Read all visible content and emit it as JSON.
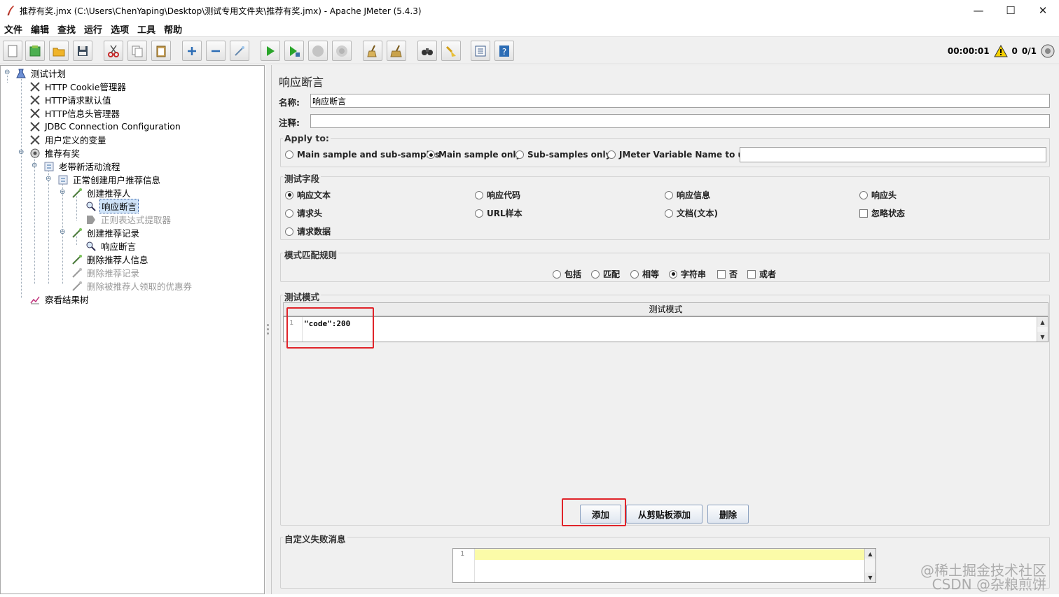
{
  "window": {
    "title": "推荐有奖.jmx (C:\\Users\\ChenYaping\\Desktop\\测试专用文件夹\\推荐有奖.jmx) - Apache JMeter (5.4.3)",
    "minimize": "—",
    "maximize": "☐",
    "close": "✕"
  },
  "menu": [
    "文件",
    "编辑",
    "查找",
    "运行",
    "选项",
    "工具",
    "帮助"
  ],
  "toolbar": {
    "timer": "00:00:01",
    "warnings": "0",
    "threads": "0/1"
  },
  "tree": {
    "items": [
      {
        "label": "测试计划",
        "icon": "test-plan-icon"
      },
      {
        "label": "HTTP Cookie管理器",
        "icon": "config-icon"
      },
      {
        "label": "HTTP请求默认值",
        "icon": "config-icon"
      },
      {
        "label": "HTTP信息头管理器",
        "icon": "config-icon"
      },
      {
        "label": "JDBC Connection Configuration",
        "icon": "config-icon"
      },
      {
        "label": "用户定义的变量",
        "icon": "config-icon"
      },
      {
        "label": "推荐有奖",
        "icon": "thread-group-icon"
      },
      {
        "label": "老带新活动流程",
        "icon": "controller-icon"
      },
      {
        "label": "正常创建用户推荐信息",
        "icon": "controller-icon"
      },
      {
        "label": "创建推荐人",
        "icon": "sampler-icon"
      },
      {
        "label": "响应断言",
        "icon": "assertion-icon"
      },
      {
        "label": "正则表达式提取器",
        "icon": "extractor-icon"
      },
      {
        "label": "创建推荐记录",
        "icon": "sampler-icon"
      },
      {
        "label": "响应断言",
        "icon": "assertion-icon"
      },
      {
        "label": "删除推荐人信息",
        "icon": "sampler-icon"
      },
      {
        "label": "删除推荐记录",
        "icon": "sampler-icon"
      },
      {
        "label": "删除被推荐人领取的优惠券",
        "icon": "sampler-icon"
      },
      {
        "label": "察看结果树",
        "icon": "listener-icon"
      }
    ]
  },
  "panel": {
    "heading": "响应断言",
    "name_label": "名称:",
    "name_value": "响应断言",
    "comment_label": "注释:",
    "comment_value": "",
    "apply_to": {
      "title": "Apply to:",
      "options": [
        "Main sample and sub-samples",
        "Main sample only",
        "Sub-samples only",
        "JMeter Variable Name to use"
      ],
      "selected": "Main sample only",
      "variable_value": ""
    },
    "field_to_test": {
      "title": "测试字段",
      "options": [
        "响应文本",
        "响应代码",
        "响应信息",
        "响应头",
        "请求头",
        "URL样本",
        "文档(文本)",
        "忽略状态",
        "请求数据"
      ],
      "selected": "响应文本",
      "ignore_status_checked": false
    },
    "pattern_rules": {
      "title": "模式匹配规则",
      "options": [
        "包括",
        "匹配",
        "相等",
        "字符串",
        "否",
        "或者"
      ],
      "selected": "字符串"
    },
    "patterns": {
      "title": "测试模式",
      "column_header": "测试模式",
      "line_number": "1",
      "value": "\"code\":200"
    },
    "buttons": {
      "add": "添加",
      "add_clipboard": "从剪贴板添加",
      "delete": "删除"
    },
    "custom_failure": {
      "title": "自定义失败消息",
      "line_number": "1",
      "value": ""
    }
  },
  "watermark": {
    "line1": "@稀土掘金技术社区",
    "line2": "CSDN @杂粮煎饼"
  },
  "colors": {
    "highlight_box": "#e0242a",
    "editor_yellow": "#fbfba8",
    "selection": "#cfe3f8"
  }
}
